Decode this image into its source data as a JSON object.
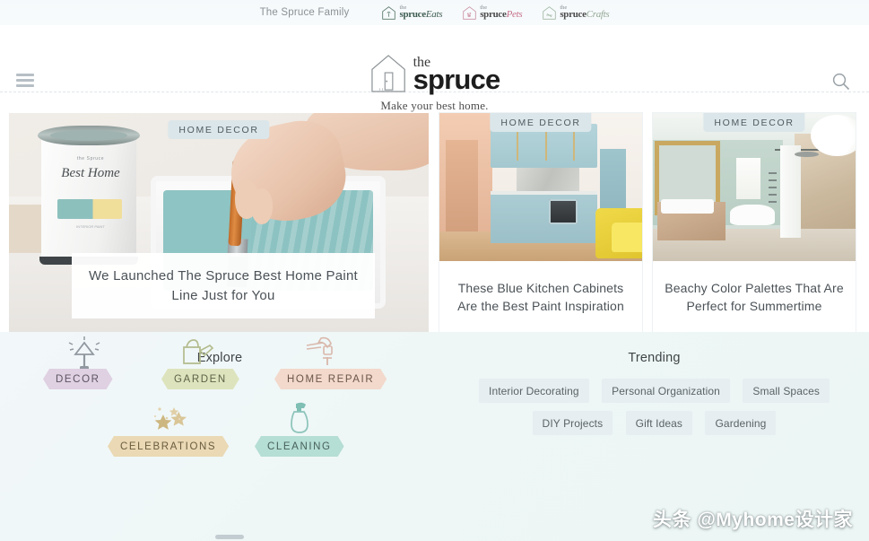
{
  "family_bar": {
    "label": "The Spruce Family",
    "brands": [
      {
        "the": "the",
        "name": "spruce",
        "tail": "Eats",
        "color": "#2f4f43",
        "icon": "house-whisk-icon"
      },
      {
        "the": "the",
        "name": "spruce",
        "tail": "Pets",
        "color": "#c0617f",
        "icon": "house-paw-icon"
      },
      {
        "the": "the",
        "name": "spruce",
        "tail": "Crafts",
        "color": "#8aa08c",
        "icon": "house-craft-icon"
      }
    ]
  },
  "header": {
    "menu_icon": "hamburger-icon",
    "search_icon": "search-icon",
    "logo_icon": "house-logo-icon",
    "logo_the": "the",
    "logo_name": "spruce",
    "tagline": "Make your best home."
  },
  "cards": [
    {
      "badge": "HOME DECOR",
      "title": "We Launched The Spruce Best Home Paint Line Just for You",
      "photo": "paint-tray-photo",
      "photo_text": {
        "brand_small": "the Spruce",
        "brand_script": "Best Home",
        "foot": "INTERIOR PAINT"
      }
    },
    {
      "badge": "HOME DECOR",
      "title": "These Blue Kitchen Cabinets Are the Best Paint Inspiration",
      "photo": "blue-kitchen-photo"
    },
    {
      "badge": "HOME DECOR",
      "title": "Beachy Color Palettes That Are Perfect for Summertime",
      "photo": "mint-bathroom-photo"
    }
  ],
  "explore": {
    "title": "Explore",
    "items": [
      {
        "label": "DECOR",
        "icon": "lamp-icon",
        "chip_bg": "#dfd0e2",
        "text": "#5c5560"
      },
      {
        "label": "GARDEN",
        "icon": "watering-can-icon",
        "chip_bg": "#dde4bd",
        "text": "#5d6147"
      },
      {
        "label": "HOME REPAIR",
        "icon": "hammer-icon",
        "chip_bg": "#f2d9cc",
        "text": "#6b5549"
      },
      {
        "label": "CELEBRATIONS",
        "icon": "stars-icon",
        "chip_bg": "#ead9b4",
        "text": "#6b5c3f"
      },
      {
        "label": "CLEANING",
        "icon": "spray-bottle-icon",
        "chip_bg": "#b5ded4",
        "text": "#47615a"
      }
    ]
  },
  "trending": {
    "title": "Trending",
    "rows": [
      [
        "Interior Decorating",
        "Personal Organization",
        "Small Spaces"
      ],
      [
        "DIY Projects",
        "Gift Ideas",
        "Gardening"
      ]
    ]
  },
  "decoration": {
    "grass": "grass-flowers-illustration",
    "flowers": [
      "#e8b9c6",
      "#bcccdd",
      "#f2e3a8",
      "#ccd8e4"
    ]
  },
  "watermark": {
    "text": "头条 @Myhome设计家"
  },
  "theme": {
    "page_bg": "#ffffff",
    "lower_bg": "#eef7f6",
    "badge_bg": "#dbe6ea",
    "tag_bg": "#e6eef1",
    "text": "#4b5257"
  }
}
